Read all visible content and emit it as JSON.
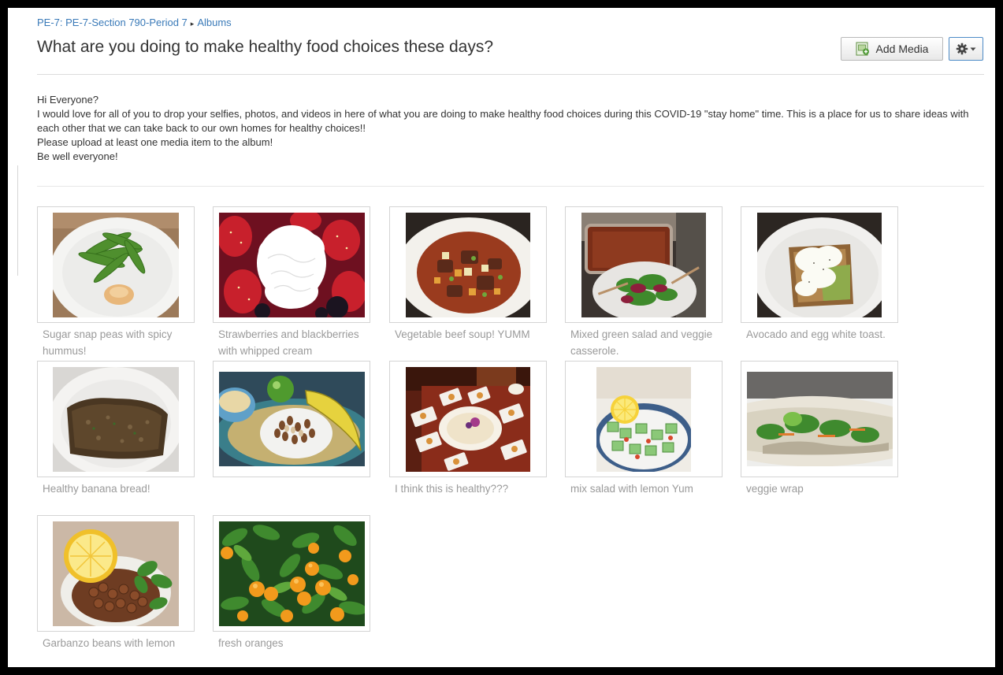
{
  "breadcrumb": {
    "course": "PE-7: PE-7-Section 790-Period 7",
    "separator": "▸",
    "section": "Albums"
  },
  "title": "What are you doing to make healthy food choices these days?",
  "toolbar": {
    "add_media_label": "Add Media",
    "add_media_icon": "add-media-icon",
    "settings_icon": "gear-icon"
  },
  "description": [
    "Hi Everyone?",
    "I would love for all of you to drop your selfies, photos, and videos in here of what you are doing to make healthy food choices during this COVID-19 \"stay home\" time. This is a place for us to share ideas with each other that we can take back to our own homes for healthy choices!!",
    "Please upload at least one media item to the album!",
    "Be well everyone!"
  ],
  "media": [
    {
      "caption": "Sugar snap peas with spicy hummus!"
    },
    {
      "caption": "Strawberries and blackberries with whipped cream"
    },
    {
      "caption": "Vegetable beef soup! YUMM"
    },
    {
      "caption": "Mixed green salad and veggie casserole."
    },
    {
      "caption": "Avocado and egg white toast."
    },
    {
      "caption": "Healthy banana bread!"
    },
    {
      "caption": ""
    },
    {
      "caption": "I think this is healthy???"
    },
    {
      "caption": "mix salad with lemon Yum"
    },
    {
      "caption": "veggie wrap"
    },
    {
      "caption": "Garbanzo beans with lemon"
    },
    {
      "caption": "fresh oranges"
    }
  ],
  "colors": {
    "link": "#3a7ab8",
    "caption": "#9a9a9a",
    "title": "#333333",
    "gear_border": "#4d8bc7"
  }
}
